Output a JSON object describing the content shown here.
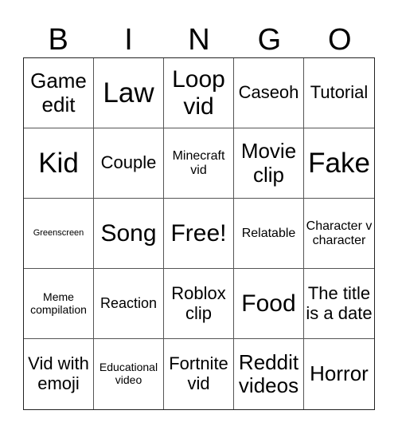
{
  "header": {
    "letters": [
      "B",
      "I",
      "N",
      "G",
      "O"
    ]
  },
  "cells": [
    {
      "text": "Game edit",
      "size": "s-ml"
    },
    {
      "text": "Law",
      "size": "s-xl"
    },
    {
      "text": "Loop vid",
      "size": "s-l"
    },
    {
      "text": "Caseoh",
      "size": "s-m"
    },
    {
      "text": "Tutorial",
      "size": "s-m"
    },
    {
      "text": "Kid",
      "size": "s-xl"
    },
    {
      "text": "Couple",
      "size": "s-m"
    },
    {
      "text": "Minecraft vid",
      "size": "s-s"
    },
    {
      "text": "Movie clip",
      "size": "s-ml"
    },
    {
      "text": "Fake",
      "size": "s-xl"
    },
    {
      "text": "Greenscreen",
      "size": "s-xxs"
    },
    {
      "text": "Song",
      "size": "s-l"
    },
    {
      "text": "Free!",
      "size": "s-l"
    },
    {
      "text": "Relatable",
      "size": "s-s"
    },
    {
      "text": "Character v character",
      "size": "s-s"
    },
    {
      "text": "Meme compilation",
      "size": "s-xs"
    },
    {
      "text": "Reaction",
      "size": "s-sm"
    },
    {
      "text": "Roblox clip",
      "size": "s-m"
    },
    {
      "text": "Food",
      "size": "s-l"
    },
    {
      "text": "The title is a date",
      "size": "s-m"
    },
    {
      "text": "Vid with emoji",
      "size": "s-m"
    },
    {
      "text": "Educational video",
      "size": "s-xs"
    },
    {
      "text": "Fortnite vid",
      "size": "s-m"
    },
    {
      "text": "Reddit videos",
      "size": "s-ml"
    },
    {
      "text": "Horror",
      "size": "s-ml"
    }
  ]
}
